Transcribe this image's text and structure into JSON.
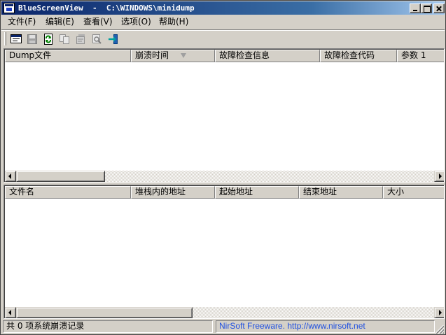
{
  "window": {
    "title": "BlueScreenView  -  C:\\WINDOWS\\minidump"
  },
  "menu": {
    "items": [
      "文件(F)",
      "编辑(E)",
      "查看(V)",
      "选项(O)",
      "帮助(H)"
    ]
  },
  "toolbar": {
    "buttons": [
      "properties-icon",
      "save-icon",
      "refresh-icon",
      "copy-icon",
      "advanced-options-icon",
      "find-icon",
      "exit-icon"
    ]
  },
  "crash_list": {
    "columns": [
      "Dump文件",
      "崩溃时间",
      "故障检查信息",
      "故障检查代码",
      "参数 1"
    ],
    "sorted_column": "崩溃时间",
    "rows": []
  },
  "driver_list": {
    "columns": [
      "文件名",
      "堆栈内的地址",
      "起始地址",
      "结束地址",
      "大小"
    ],
    "rows": []
  },
  "status": {
    "count_text": "共 0 项系统崩溃记录",
    "credit_text": "NirSoft Freeware.  http://www.nirsoft.net"
  },
  "colors": {
    "title_gradient_start": "#0a246a",
    "link_blue": "#2050e0",
    "face": "#d4d0c8"
  }
}
